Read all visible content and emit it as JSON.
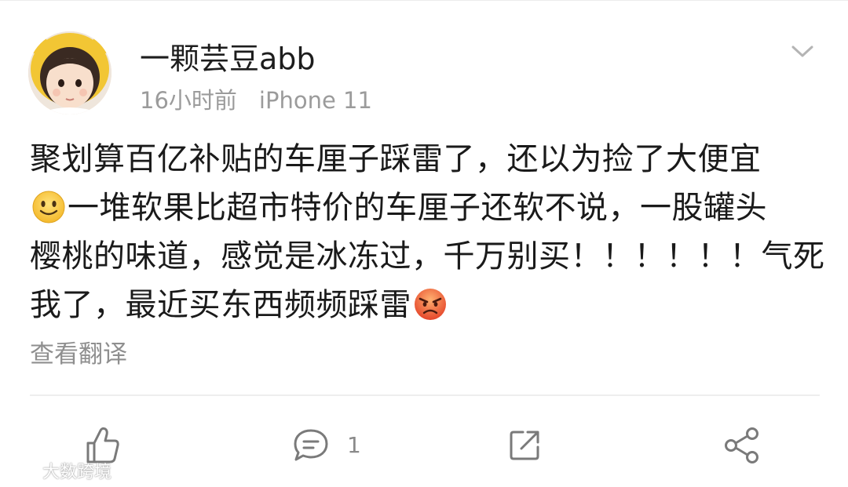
{
  "post": {
    "author": "一颗芸豆abb",
    "time": "16小时前",
    "device": "iPhone 11",
    "lines": [
      "聚划算百亿补贴的车厘子踩雷了，还以为捡了大便宜",
      "一堆软果比超市特价的车厘子还软不说，一股罐头",
      "樱桃的味道，感觉是冰冻过，千万别买！！！！！！气死",
      "我了，最近买东西频频踩雷"
    ],
    "inline_emojis": [
      "smile-emoji",
      "angry-emoji"
    ],
    "translate_label": "查看翻译"
  },
  "actions": {
    "like": {
      "icon": "thumbs-up-icon"
    },
    "comment": {
      "icon": "comment-icon",
      "count": "1"
    },
    "repost": {
      "icon": "repost-icon"
    },
    "share": {
      "icon": "share-icon"
    }
  },
  "watermark": {
    "text": "大数跨境"
  },
  "colors": {
    "text": "#1a1a1a",
    "meta": "#9b9b9b",
    "icon": "#7a7a7a",
    "emoji_yellow": "#f7c948",
    "emoji_angry": "#e8552f"
  }
}
